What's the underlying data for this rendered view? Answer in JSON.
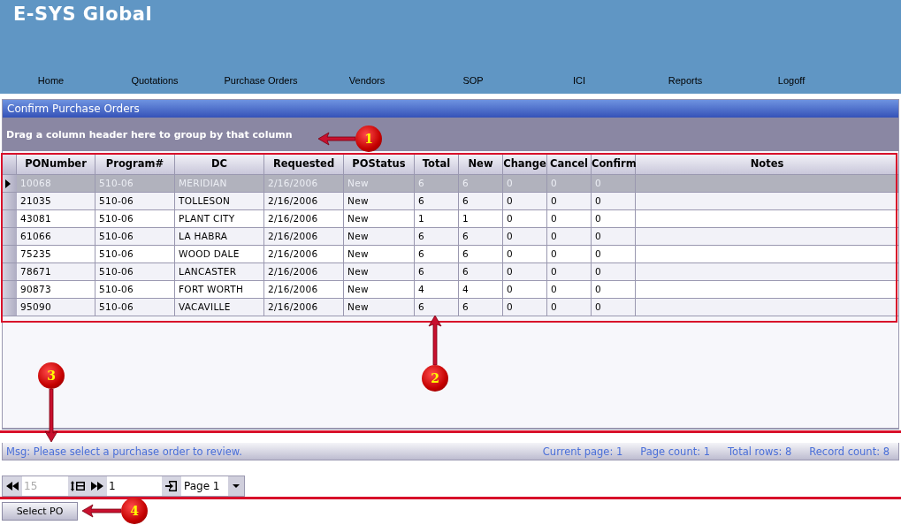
{
  "header": {
    "logo": "E-SYS Global",
    "nav": [
      "Home",
      "Quotations",
      "Purchase Orders",
      "Vendors",
      "SOP",
      "ICI",
      "Reports",
      "Logoff"
    ]
  },
  "panel": {
    "title": "Confirm Purchase Orders",
    "group_hint": "Drag a column header here to group by that column"
  },
  "table": {
    "columns": [
      "PONumber",
      "Program#",
      "DC",
      "Requested",
      "POStatus",
      "Total",
      "New",
      "Change",
      "Cancel",
      "Confirm",
      "Notes"
    ],
    "rows": [
      {
        "selected": true,
        "cells": [
          "10068",
          "510-06",
          "MERIDIAN",
          "2/16/2006",
          "New",
          "6",
          "6",
          "0",
          "0",
          "0"
        ]
      },
      {
        "selected": false,
        "cells": [
          "21035",
          "510-06",
          "TOLLESON",
          "2/16/2006",
          "New",
          "6",
          "6",
          "0",
          "0",
          "0"
        ]
      },
      {
        "selected": false,
        "cells": [
          "43081",
          "510-06",
          "PLANT CITY",
          "2/16/2006",
          "New",
          "1",
          "1",
          "0",
          "0",
          "0"
        ]
      },
      {
        "selected": false,
        "cells": [
          "61066",
          "510-06",
          "LA HABRA",
          "2/16/2006",
          "New",
          "6",
          "6",
          "0",
          "0",
          "0"
        ]
      },
      {
        "selected": false,
        "cells": [
          "75235",
          "510-06",
          "WOOD DALE",
          "2/16/2006",
          "New",
          "6",
          "6",
          "0",
          "0",
          "0"
        ]
      },
      {
        "selected": false,
        "cells": [
          "78671",
          "510-06",
          "LANCASTER",
          "2/16/2006",
          "New",
          "6",
          "6",
          "0",
          "0",
          "0"
        ]
      },
      {
        "selected": false,
        "cells": [
          "90873",
          "510-06",
          "FORT WORTH",
          "2/16/2006",
          "New",
          "4",
          "4",
          "0",
          "0",
          "0"
        ]
      },
      {
        "selected": false,
        "cells": [
          "95090",
          "510-06",
          "VACAVILLE",
          "2/16/2006",
          "New",
          "6",
          "6",
          "0",
          "0",
          "0"
        ]
      }
    ]
  },
  "status_bar": {
    "message": "Msg: Please select a purchase order to review.",
    "stats": [
      "Current page: 1",
      "Page count: 1",
      "Total rows: 8",
      "Record count: 8"
    ]
  },
  "pager": {
    "page_size": {
      "placeholder": "15"
    },
    "page_number": {
      "value": "1"
    },
    "page_select": "Page 1"
  },
  "buttons": [
    "Select PO"
  ],
  "callouts": [
    "1",
    "2",
    "3",
    "4"
  ]
}
